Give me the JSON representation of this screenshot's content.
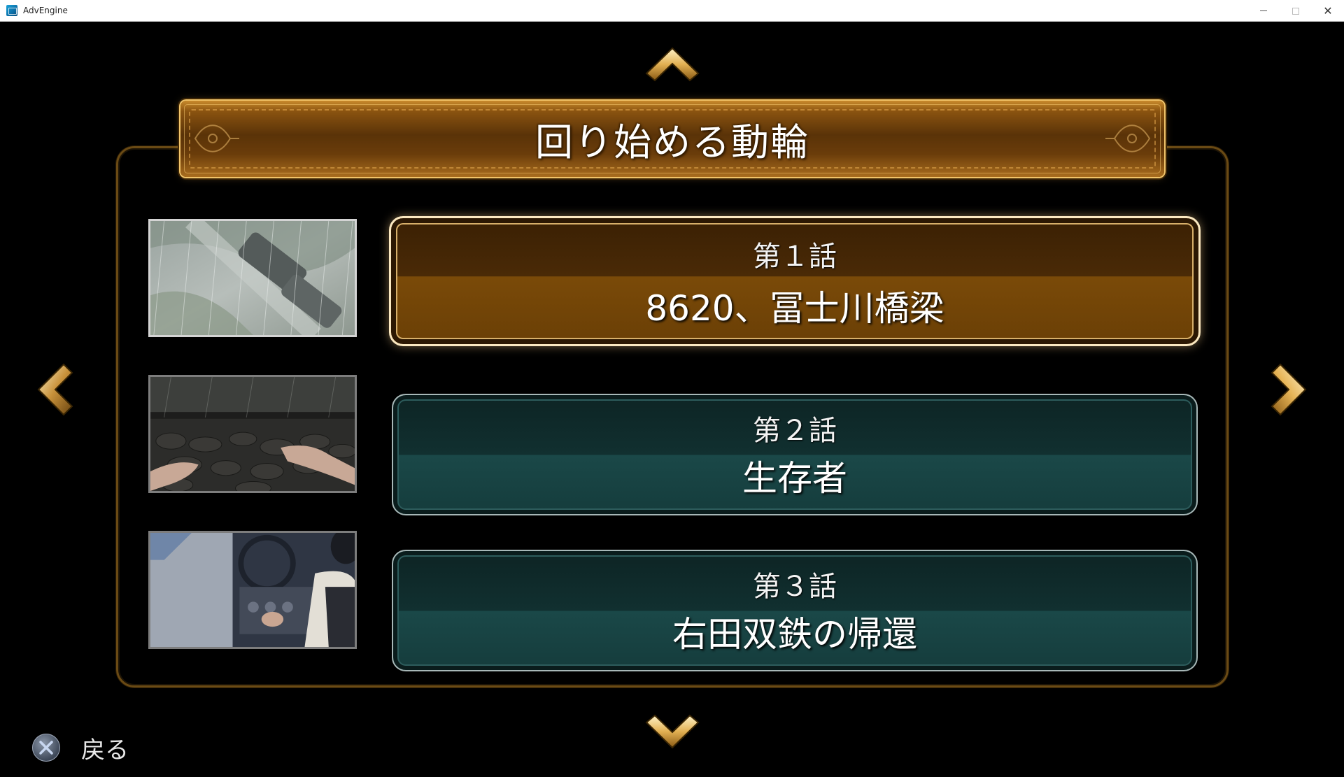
{
  "window": {
    "title": "AdvEngine",
    "controls": [
      "minimize",
      "maximize",
      "close"
    ],
    "close_glyph": "✕"
  },
  "header": {
    "chapter_title": "回り始める動輪"
  },
  "navigation": {
    "up_icon": "chevron-up-icon",
    "down_icon": "chevron-down-icon",
    "left_icon": "chevron-left-icon",
    "right_icon": "chevron-right-icon"
  },
  "episodes": [
    {
      "number": "第１話",
      "title": "8620、冨士川橋梁",
      "selected": true,
      "thumbnail": "rainy-train-aerial"
    },
    {
      "number": "第２話",
      "title": "生存者",
      "selected": false,
      "thumbnail": "hands-on-rubble"
    },
    {
      "number": "第３話",
      "title": "右田双鉄の帰還",
      "selected": false,
      "thumbnail": "train-cab-driver"
    }
  ],
  "footer": {
    "back_label": "戻る",
    "back_icon": "cross-button-icon"
  },
  "colors": {
    "gold_accent": "#d9a54a",
    "teal_card": "#1a4848",
    "frame_brown": "#6a4a14"
  }
}
